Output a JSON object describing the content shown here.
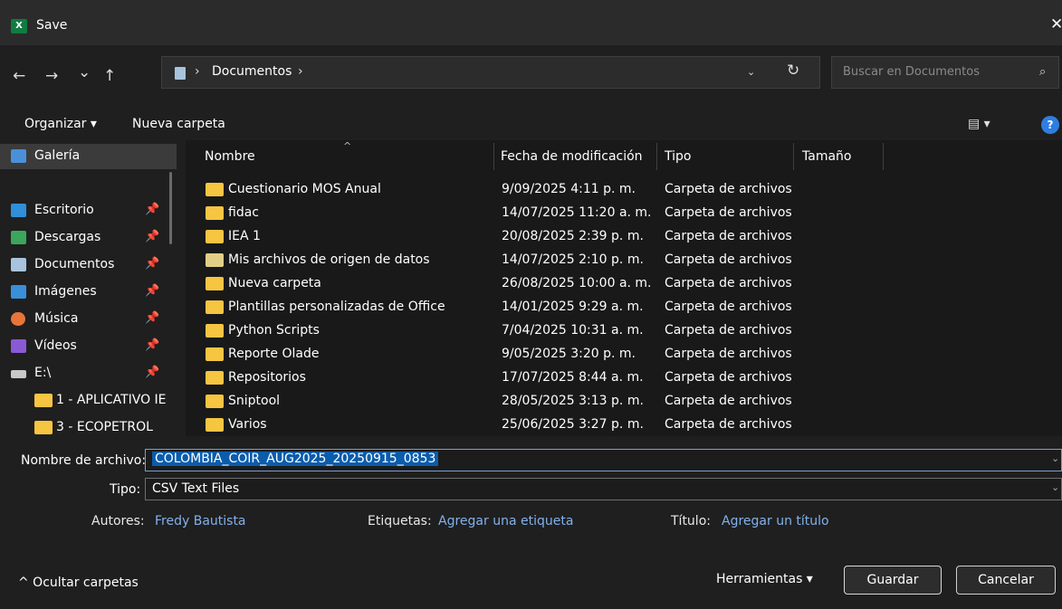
{
  "window": {
    "title": "Save",
    "app_icon": "X",
    "close": "✕"
  },
  "nav": {
    "back": "←",
    "forward": "→",
    "recent": "⌄",
    "up": "↑",
    "path_chevron": "›",
    "path": "Documentos",
    "path_trailing": "›",
    "dropdown": "⌄",
    "refresh": "↻",
    "search_placeholder": "Buscar en Documentos",
    "search_icon": "⌕"
  },
  "toolbar": {
    "organize": "Organizar ▾",
    "new_folder": "Nueva carpeta",
    "view": "▤ ▾",
    "help": "?"
  },
  "sidebar": {
    "items": [
      {
        "label": "Galería",
        "icon": "gallery-icon",
        "color": "#4a90d9",
        "pinned": false,
        "selected": true
      },
      {
        "label": "Escritorio",
        "icon": "desktop-icon",
        "color": "#2f8fd8",
        "pinned": true
      },
      {
        "label": "Descargas",
        "icon": "download-icon",
        "color": "#3ba55c",
        "pinned": true
      },
      {
        "label": "Documentos",
        "icon": "document-icon",
        "color": "#a9c3de",
        "pinned": true
      },
      {
        "label": "Imágenes",
        "icon": "pictures-icon",
        "color": "#3a8fd9",
        "pinned": true
      },
      {
        "label": "Música",
        "icon": "music-icon",
        "color": "#e8743b",
        "pinned": true
      },
      {
        "label": "Vídeos",
        "icon": "videos-icon",
        "color": "#8a5ad6",
        "pinned": true
      },
      {
        "label": "E:\\",
        "icon": "drive-icon",
        "color": "#c8c8c8",
        "pinned": true
      },
      {
        "label": "1 - APLICATIVO IE",
        "icon": "folder-icon",
        "color": "#f6c542",
        "pinned": false
      },
      {
        "label": "3 - ECOPETROL",
        "icon": "folder-icon",
        "color": "#f6c542",
        "pinned": false
      }
    ],
    "pin_glyph": "📌"
  },
  "columns": {
    "name": "Nombre",
    "date": "Fecha de modificación",
    "type": "Tipo",
    "size": "Tamaño",
    "sort_caret": "^"
  },
  "files": [
    {
      "name": "Cuestionario MOS Anual",
      "date": "9/09/2025 4:11 p. m.",
      "type": "Carpeta de archivos"
    },
    {
      "name": "fidac",
      "date": "14/07/2025 11:20 a. m.",
      "type": "Carpeta de archivos"
    },
    {
      "name": "IEA 1",
      "date": "20/08/2025 2:39 p. m.",
      "type": "Carpeta de archivos"
    },
    {
      "name": "Mis archivos de origen de datos",
      "date": "14/07/2025 2:10 p. m.",
      "type": "Carpeta de archivos",
      "special": true
    },
    {
      "name": "Nueva carpeta",
      "date": "26/08/2025 10:00 a. m.",
      "type": "Carpeta de archivos"
    },
    {
      "name": "Plantillas personalizadas de Office",
      "date": "14/01/2025 9:29 a. m.",
      "type": "Carpeta de archivos"
    },
    {
      "name": "Python Scripts",
      "date": "7/04/2025 10:31 a. m.",
      "type": "Carpeta de archivos"
    },
    {
      "name": "Reporte Olade",
      "date": "9/05/2025 3:20 p. m.",
      "type": "Carpeta de archivos"
    },
    {
      "name": "Repositorios",
      "date": "17/07/2025 8:44 a. m.",
      "type": "Carpeta de archivos"
    },
    {
      "name": "Sniptool",
      "date": "28/05/2025 3:13 p. m.",
      "type": "Carpeta de archivos"
    },
    {
      "name": "Varios",
      "date": "25/06/2025 3:27 p. m.",
      "type": "Carpeta de archivos"
    }
  ],
  "form": {
    "filename_label": "Nombre de archivo:",
    "filename_value": "COLOMBIA_COIR_AUG2025_20250915_0853",
    "type_label": "Tipo:",
    "type_value": "CSV Text Files",
    "dropdown": "⌄",
    "authors_label": "Autores:",
    "authors_value": "Fredy Bautista",
    "tags_label": "Etiquetas:",
    "tags_value": "Agregar una etiqueta",
    "title_label": "Título:",
    "title_value": "Agregar un título"
  },
  "footer": {
    "hide_folders": "^  Ocultar carpetas",
    "tools": "Herramientas   ▾",
    "save": "Guardar",
    "cancel": "Cancelar"
  }
}
